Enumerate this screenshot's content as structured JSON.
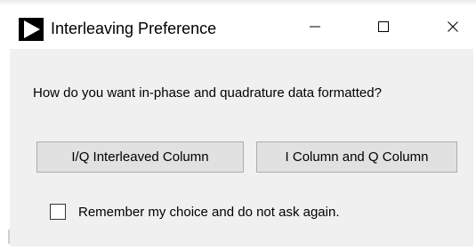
{
  "window": {
    "title": "Interleaving Preference",
    "icon": "play-triangle-icon",
    "controls": {
      "minimize": "minimize-icon",
      "maximize": "maximize-icon",
      "close": "close-icon"
    }
  },
  "dialog": {
    "prompt": "How do you want in-phase and quadrature data formatted?",
    "buttons": {
      "interleaved_label": "I/Q Interleaved Column",
      "separate_label": "I Column and Q Column"
    },
    "remember": {
      "label": "Remember my choice and do not ask again.",
      "checked": false
    }
  },
  "colors": {
    "dialog_background": "#f0f0f0",
    "button_face": "#e1e1e1",
    "button_border": "#adadad",
    "titlebar": "#ffffff"
  }
}
